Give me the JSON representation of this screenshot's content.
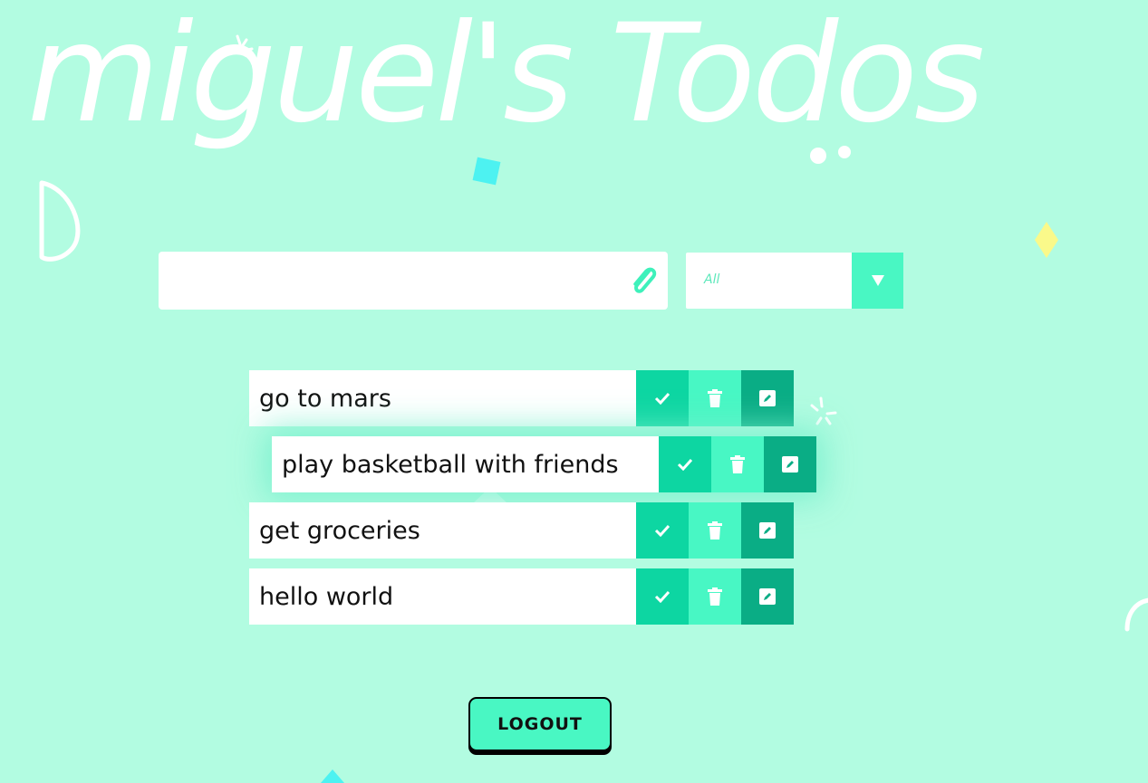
{
  "app": {
    "title": "miguel's Todos"
  },
  "add_form": {
    "input_value": "",
    "attach_icon": "paperclip-icon"
  },
  "filter": {
    "selected": "All",
    "arrow_icon": "triangle-down-icon"
  },
  "todos": [
    {
      "text": "go to mars"
    },
    {
      "text": "play basketball with friends"
    },
    {
      "text": "get groceries"
    },
    {
      "text": "hello world"
    }
  ],
  "todo_actions": {
    "complete_icon": "check-icon",
    "delete_icon": "trash-icon",
    "edit_icon": "edit-icon"
  },
  "logout": {
    "label": "LOGOUT"
  },
  "colors": {
    "background": "#b2fce1",
    "accent": "#49f7c3",
    "check": "#0dd6a2",
    "edit": "#0aad85"
  }
}
